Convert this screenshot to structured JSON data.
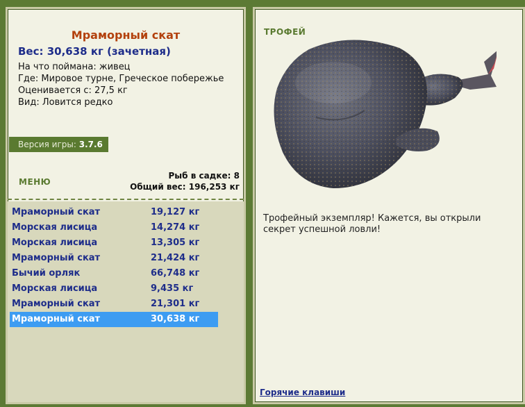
{
  "fish": {
    "title": "Мраморный скат",
    "weight_line": "Вес: 30,638 кг (зачетная)",
    "caught_on": "На что поймана: живец",
    "location": "Где: Мировое турне, Греческое побережье",
    "valued_from": "Оценивается с: 27,5 кг",
    "rarity": "Вид: Ловится редко"
  },
  "version": {
    "label": "Версия игры:",
    "value": "3.7.6"
  },
  "menu_label": "МЕНЮ",
  "stats": {
    "count": "Рыб в садке: 8",
    "total": "Общий вес: 196,253 кг"
  },
  "catch_list": [
    {
      "name": "Мраморный скат",
      "weight": "19,127 кг"
    },
    {
      "name": "Морская лисица",
      "weight": "14,274 кг"
    },
    {
      "name": "Морская лисица",
      "weight": "13,305 кг"
    },
    {
      "name": "Мраморный скат",
      "weight": "21,424 кг"
    },
    {
      "name": "Бычий орляк",
      "weight": "66,748 кг"
    },
    {
      "name": "Морская лисица",
      "weight": "9,435 кг"
    },
    {
      "name": "Мраморный скат",
      "weight": "21,301 кг"
    },
    {
      "name": "Мраморный скат",
      "weight": "30,638 кг"
    }
  ],
  "selected_index": 7,
  "trophy": {
    "label": "ТРОФЕЙ",
    "message": "Трофейный экземпляр! Кажется, вы открыли секрет успешной ловли!",
    "hotkeys": "Горячие клавиши"
  }
}
